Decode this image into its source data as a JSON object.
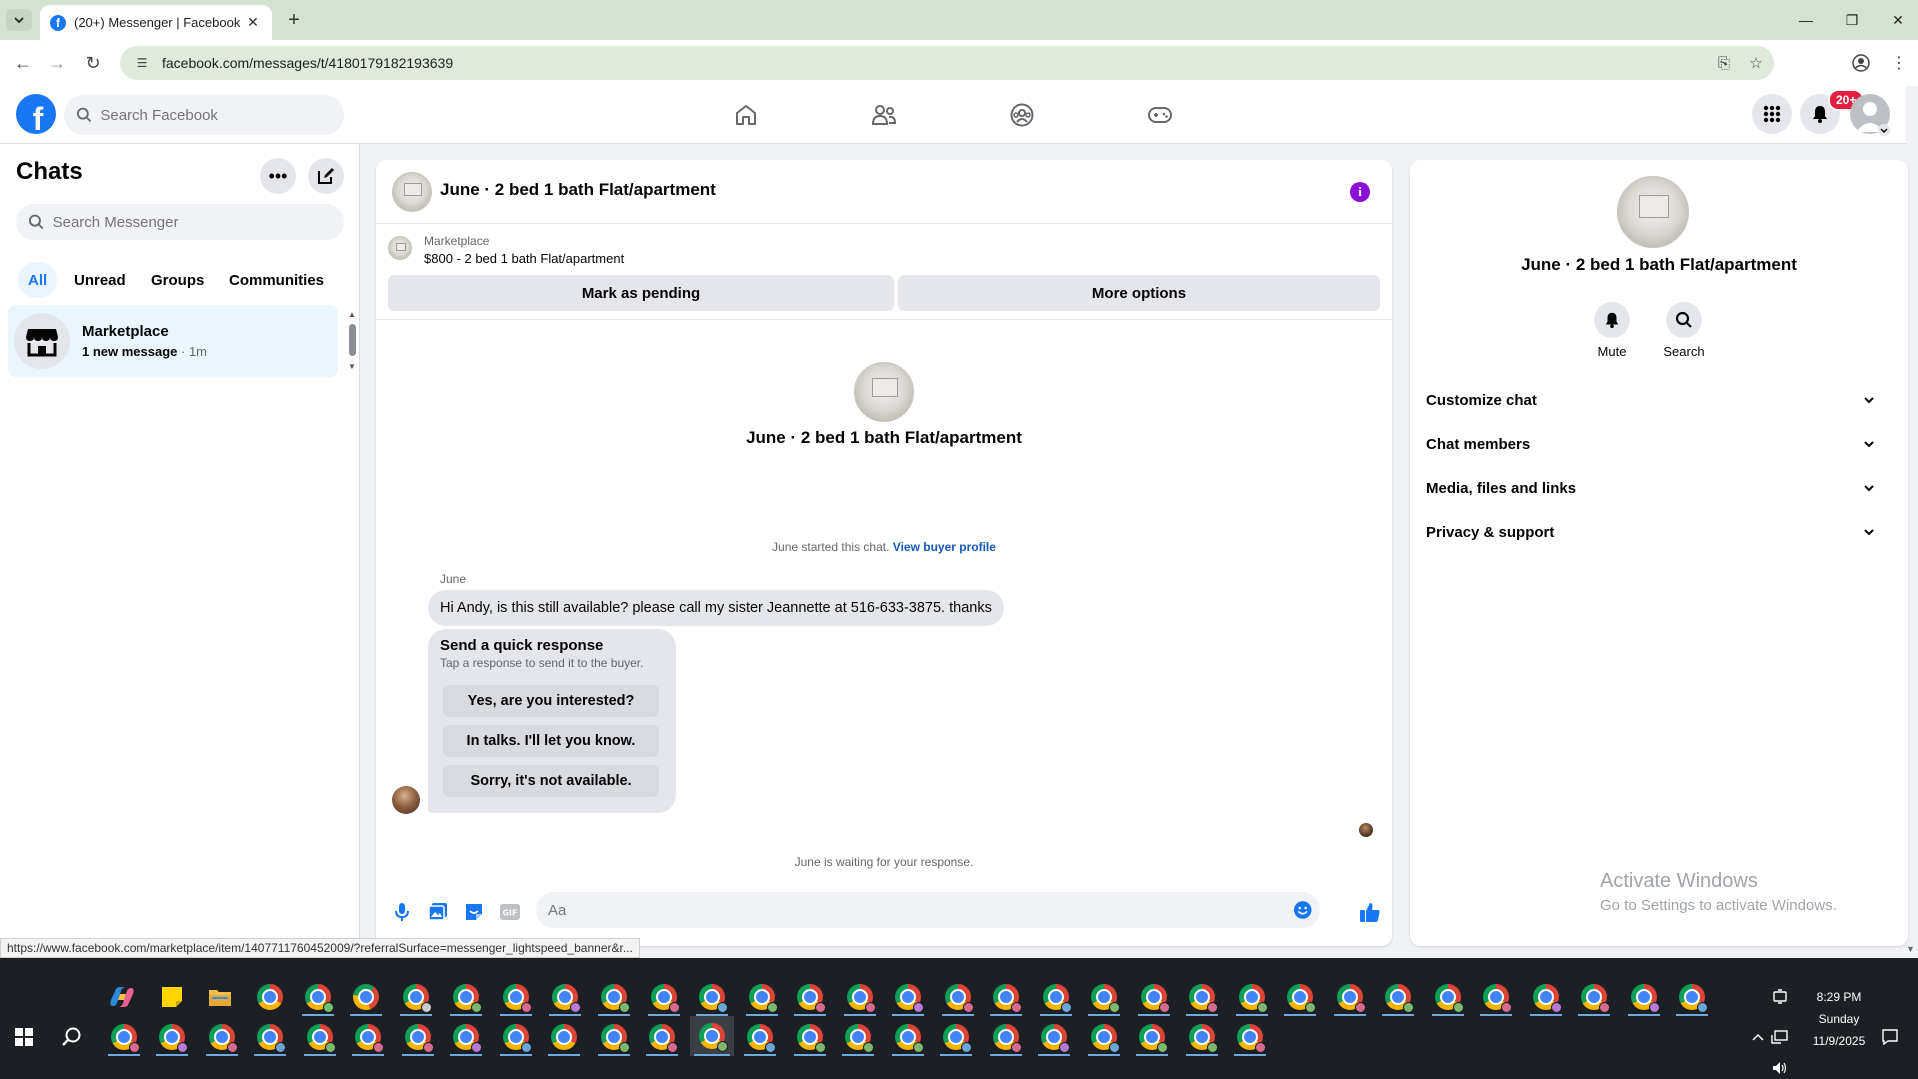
{
  "browser": {
    "tab_title": "(20+) Messenger | Facebook",
    "tab_favicon": "f",
    "url": "facebook.com/messages/t/4180179182193639",
    "status_url": "https://www.facebook.com/marketplace/item/1407711760452009/?referralSurface=messenger_lightspeed_banner&r..."
  },
  "fb_header": {
    "search_placeholder": "Search Facebook",
    "notification_badge": "20+"
  },
  "chats": {
    "title": "Chats",
    "search_placeholder": "Search Messenger",
    "filters": [
      "All",
      "Unread",
      "Groups",
      "Communities"
    ],
    "active_filter": "All",
    "list": [
      {
        "name": "Marketplace",
        "preview": "1 new message",
        "time": " · 1m"
      }
    ]
  },
  "conversation": {
    "title": "June · 2 bed 1 bath Flat/apartment",
    "marketplace_label": "Marketplace",
    "listing": "$800 - 2 bed 1 bath Flat/apartment",
    "mark_pending": "Mark as pending",
    "more_options": "More options",
    "intro_title": "June · 2 bed 1 bath Flat/apartment",
    "started_text": "June started this chat.",
    "view_buyer_profile": "View buyer profile",
    "sender": "June",
    "message": "Hi Andy, is this still available? please call my sister Jeannette at 516-633-3875. thanks",
    "quick_title": "Send a quick response",
    "quick_subtitle": "Tap a response to send it to the buyer.",
    "quick_responses": [
      "Yes, are you interested?",
      "In talks. I'll let you know.",
      "Sorry, it's not available."
    ],
    "waiting": "June is waiting for your response.",
    "composer_placeholder": "Aa"
  },
  "info_panel": {
    "title": "June · 2 bed 1 bath Flat/apartment",
    "mute": "Mute",
    "search": "Search",
    "sections": [
      "Customize chat",
      "Chat members",
      "Media, files and links",
      "Privacy & support"
    ]
  },
  "watermark": {
    "line1": "Activate Windows",
    "line2": "Go to Settings to activate Windows."
  },
  "taskbar": {
    "time": "8:29 PM",
    "day": "Sunday",
    "date": "11/9/2025"
  },
  "colors": {
    "fb_blue": "#1877f2",
    "info_purple": "#8b0fd8",
    "badge_red": "#e41e3f",
    "chrome_green": "#d3e3d0"
  }
}
